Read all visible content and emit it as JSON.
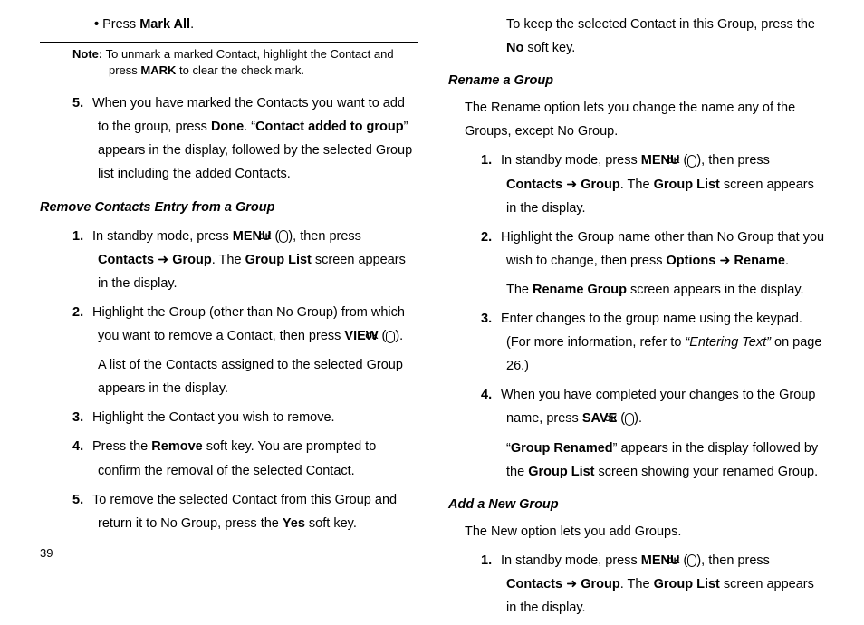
{
  "ok_label": "OK",
  "page_number": "39",
  "left": {
    "bullet1_a": "Press ",
    "bullet1_b": "Mark All",
    "bullet1_c": ".",
    "note_a": "Note:",
    "note_b": " To unmark a marked Contact, highlight the Contact and press ",
    "note_c": "MARK",
    "note_d": " to clear the check mark.",
    "s5_n": "5.",
    "s5_a": "When you have marked the Contacts you want to add to the group, press ",
    "s5_b": "Done",
    "s5_c": ". “",
    "s5_d": "Contact added to group",
    "s5_e": "” appears in the display, followed by the selected Group list including the added Contacts.",
    "h1": "Remove Contacts Entry from a Group",
    "r1_n": "1.",
    "r1_a": "In standby mode, press ",
    "r1_b": "MENU",
    "r1_c": " (",
    "r1_d": "), then press ",
    "r1_e": "Contacts",
    "r1_f": " ➜ ",
    "r1_g": "Group",
    "r1_h": ". The ",
    "r1_i": "Group List",
    "r1_j": " screen appears in the display.",
    "r2_n": "2.",
    "r2_a": "Highlight the Group (other than No Group) from which you want to remove a Contact, then press ",
    "r2_b": "VIEW",
    "r2_c": " (",
    "r2_d": ").",
    "r2_e": "A list of the Contacts assigned to the selected Group appears in the display.",
    "r3_n": "3.",
    "r3_a": "Highlight the Contact you wish to remove.",
    "r4_n": "4.",
    "r4_a": "Press the ",
    "r4_b": "Remove",
    "r4_c": " soft key. You are prompted to confirm the removal of the selected Contact.",
    "r5_n": "5.",
    "r5_a": "To remove the selected Contact from this Group and return it to No Group, press the ",
    "r5_b": "Yes",
    "r5_c": " soft key."
  },
  "right": {
    "top_a": "To keep the selected Contact in this Group, press the ",
    "top_b": "No",
    "top_c": " soft key.",
    "h2": "Rename a Group",
    "intro2": "The Rename option lets you change the name any of the Groups, except No Group.",
    "n1_n": "1.",
    "n1_a": "In standby mode, press ",
    "n1_b": "MENU",
    "n1_c": " (",
    "n1_d": "), then press ",
    "n1_e": "Contacts",
    "n1_f": " ➜ ",
    "n1_g": "Group",
    "n1_h": ". The ",
    "n1_i": "Group List",
    "n1_j": " screen appears in the display.",
    "n2_n": "2.",
    "n2_a": "Highlight the Group name other than No Group that you wish to change, then press ",
    "n2_b": "Options",
    "n2_c": " ➜ ",
    "n2_d": "Rename",
    "n2_e": ".",
    "n2_f": "The ",
    "n2_g": "Rename Group",
    "n2_h": " screen appears in the display.",
    "n3_n": "3.",
    "n3_a": "Enter changes to the group name using the keypad. (For more information, refer to ",
    "n3_b": "“Entering Text” ",
    "n3_c": " on page 26.)",
    "n4_n": "4.",
    "n4_a": "When you have completed your changes to the Group name, press ",
    "n4_b": "SAVE",
    "n4_c": " (",
    "n4_d": ").",
    "n4_e": "“",
    "n4_f": "Group Renamed",
    "n4_g": "” appears in the display followed by the ",
    "n4_h": "Group List",
    "n4_i": " screen showing your renamed Group.",
    "h3": "Add a New Group",
    "intro3": "The New option lets you add Groups.",
    "a1_n": "1.",
    "a1_a": "In standby mode, press ",
    "a1_b": "MENU",
    "a1_c": " (",
    "a1_d": "), then press ",
    "a1_e": "Contacts",
    "a1_f": " ➜ ",
    "a1_g": "Group",
    "a1_h": ". The ",
    "a1_i": "Group List",
    "a1_j": " screen appears in the display."
  }
}
